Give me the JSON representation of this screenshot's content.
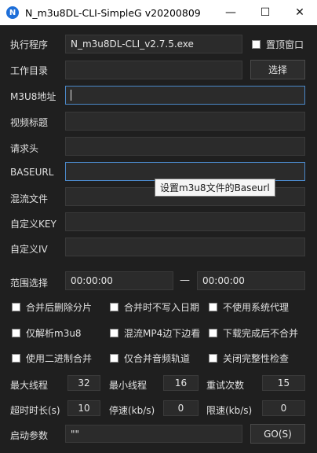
{
  "window": {
    "title": "N_m3u8DL-CLI-SimpleG v20200809",
    "app_icon_letter": "N",
    "minimize": "—",
    "maximize": "☐",
    "close": "✕"
  },
  "form": {
    "executable": {
      "label": "执行程序",
      "value": "N_m3u8DL-CLI_v2.7.5.exe"
    },
    "on_top": {
      "label": "置顶窗口",
      "checked": false
    },
    "workdir": {
      "label": "工作目录",
      "value": "",
      "button": "选择"
    },
    "m3u8_url": {
      "label": "M3U8地址",
      "value": ""
    },
    "video_title": {
      "label": "视频标题",
      "value": ""
    },
    "headers": {
      "label": "请求头",
      "value": ""
    },
    "baseurl": {
      "label": "BASEURL",
      "value": "",
      "tooltip": "设置m3u8文件的Baseurl"
    },
    "mux_file": {
      "label": "混流文件",
      "value": ""
    },
    "custom_key": {
      "label": "自定义KEY",
      "value": ""
    },
    "custom_iv": {
      "label": "自定义IV",
      "value": ""
    }
  },
  "range": {
    "label": "范围选择",
    "start": "00:00:00",
    "separator": "—",
    "end": "00:00:00"
  },
  "options": [
    {
      "label": "合并后删除分片",
      "checked": false
    },
    {
      "label": "合并时不写入日期",
      "checked": false
    },
    {
      "label": "不使用系统代理",
      "checked": false
    },
    {
      "label": "仅解析m3u8",
      "checked": false
    },
    {
      "label": "混流MP4边下边看",
      "checked": false
    },
    {
      "label": "下载完成后不合并",
      "checked": false
    },
    {
      "label": "使用二进制合并",
      "checked": false
    },
    {
      "label": "仅合并音频轨道",
      "checked": false
    },
    {
      "label": "关闭完整性检查",
      "checked": false
    }
  ],
  "params": {
    "max_threads": {
      "label": "最大线程",
      "value": "32"
    },
    "min_threads": {
      "label": "最小线程",
      "value": "16"
    },
    "retry": {
      "label": "重试次数",
      "value": "15"
    },
    "timeout": {
      "label": "超时时长(s)",
      "value": "10"
    },
    "stop_speed": {
      "label": "停速(kb/s)",
      "value": "0"
    },
    "limit_speed": {
      "label": "限速(kb/s)",
      "value": "0"
    }
  },
  "launch": {
    "label": "启动参数",
    "value": "\"\"",
    "go_button": "GO(S)"
  }
}
